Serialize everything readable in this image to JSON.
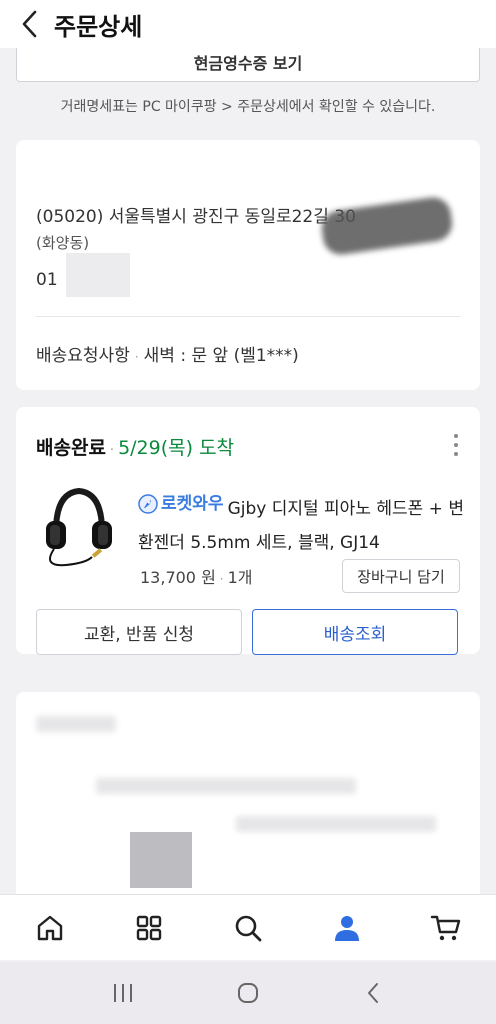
{
  "header": {
    "title": "주문상세"
  },
  "receipt_button": {
    "label": "현금영수증 보기"
  },
  "notice": "거래명세표는 PC 마이쿠팡 > 주문상세에서 확인할 수 있습니다.",
  "address": {
    "line1": "(05020) 서울특별시 광진구 동일로22길 30",
    "line2": "(화양동)",
    "phone_prefix": "01",
    "request_label": "배송요청사항",
    "request_value": "새벽 : 문 앞 (벨1***)"
  },
  "order": {
    "status": "배송완료",
    "arrival": "5/29(목) 도착",
    "badge": "로켓와우",
    "product_name": "Gjby 디지털 피아노 헤드폰 + 변환젠더 5.5mm 세트, 블랙, GJ14",
    "price": "13,700 원",
    "quantity": "1개",
    "cart_label": "장바구니 담기",
    "exchange_label": "교환, 반품 신청",
    "track_label": "배송조회"
  },
  "bottom_nav": {
    "items": [
      "home-icon",
      "category-icon",
      "search-icon",
      "user-icon",
      "cart-icon"
    ],
    "active_color": "#2f6ee0"
  },
  "colors": {
    "accent": "#2a5fcc",
    "arrival": "#0b8a3c"
  }
}
